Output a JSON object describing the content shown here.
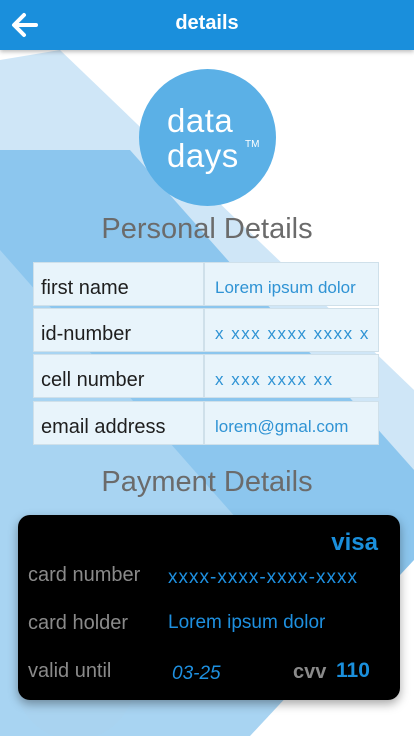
{
  "header": {
    "title": "details",
    "back_icon": "arrow-left-icon"
  },
  "logo": {
    "line1": "data",
    "line2": "days",
    "tm": "TM"
  },
  "personal": {
    "title": "Personal Details",
    "rows": [
      {
        "label": "first name",
        "value": "Lorem ipsum dolor"
      },
      {
        "label": "id-number",
        "value": "x xxx xxxx xxxx x"
      },
      {
        "label": "cell number",
        "value": "x xxx xxxx xx"
      },
      {
        "label": "email address",
        "value": "lorem@gmal.com"
      }
    ]
  },
  "payment": {
    "title": "Payment Details",
    "card": {
      "brand": "visa",
      "number_label": "card number",
      "number_value": "xxxx-xxxx-xxxx-xxxx",
      "holder_label": "card holder",
      "holder_value": "Lorem ipsum dolor",
      "valid_label": "valid until",
      "valid_value": "03-25",
      "cvv_label": "cvv",
      "cvv_value": "110"
    }
  },
  "colors": {
    "accent": "#1a8fdc",
    "background_shape_light": "#cfe6f7",
    "background_shape_mid": "#8cc6ee",
    "card_bg": "#000000"
  }
}
